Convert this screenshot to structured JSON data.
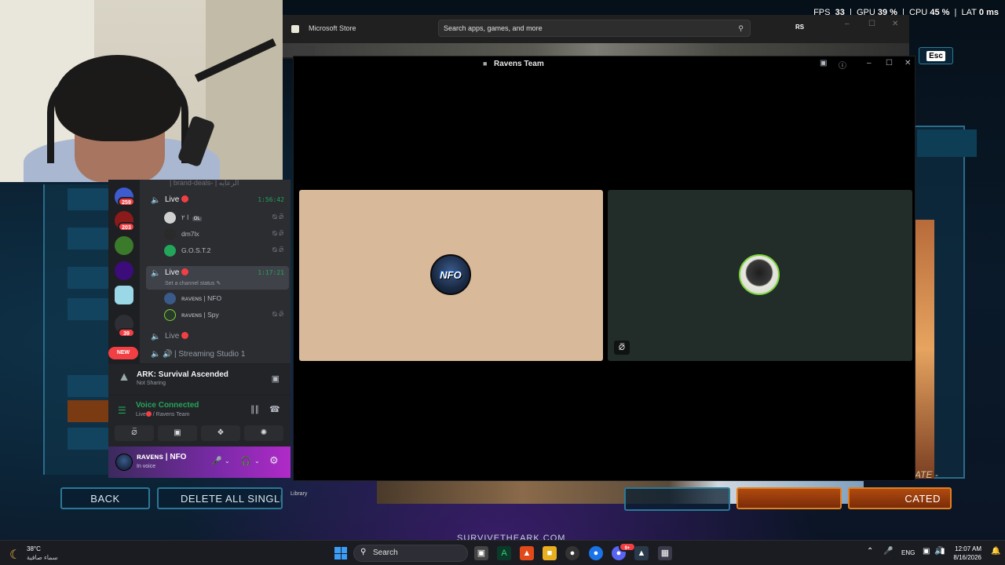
{
  "hud": {
    "fps_label": "FPS",
    "fps": "33",
    "gpu_label": "GPU",
    "gpu": "39 %",
    "cpu_label": "CPU",
    "cpu": "45 %",
    "lat_label": "LAT",
    "lat": "0 ms"
  },
  "game": {
    "esc_label": "Esc",
    "back_label": "BACK",
    "delete_label": "DELETE ALL SINGLE I",
    "cated_label": "CATED",
    "survive_text": "SURVIVETHEARK.COM",
    "create_text": "ATE -",
    "library_label": "Library"
  },
  "msstore": {
    "title": "Microsoft Store",
    "search_placeholder": "Search apps, games, and more",
    "avatar": "RS"
  },
  "ravens": {
    "title": "Ravens Team",
    "tile_a_avatar_text": "NFO"
  },
  "discord": {
    "server_badges": [
      "259",
      "203",
      "39"
    ],
    "new_pill": "NEW",
    "top_channel": "| brand-deals- | الرعايه",
    "channels": [
      {
        "name": "Live",
        "time": "1:56:42"
      },
      {
        "name": "Live",
        "time": "1:17:21",
        "sub": "Set a channel status"
      },
      {
        "name": "Live"
      }
    ],
    "members_1": [
      {
        "name": "ا ٢",
        "tag": "OL"
      },
      {
        "name": "dm7lx"
      },
      {
        "name": "G.O.S.T.2"
      }
    ],
    "members_2": [
      {
        "name": "ʀᴀᴠᴇɴs | NFO"
      },
      {
        "name": "ʀᴀᴠᴇɴs | Spy"
      }
    ],
    "streaming_channel": "| Streaming Studio 1",
    "activity": {
      "title": "ARK: Survival Ascended",
      "sub": "Not Sharing"
    },
    "voice": {
      "title": "Voice Connected",
      "channel": "Live",
      "server": "/ Ravens Team"
    },
    "user": {
      "name": "ʀᴀᴠᴇɴs | NFO",
      "status": "In voice"
    }
  },
  "taskbar": {
    "temp": "38°C",
    "condition": "سماء صافية",
    "search_label": "Search",
    "lang": "ENG",
    "time": "12:07 AM",
    "date": "8/16/2026",
    "discord_badge": "9+"
  }
}
